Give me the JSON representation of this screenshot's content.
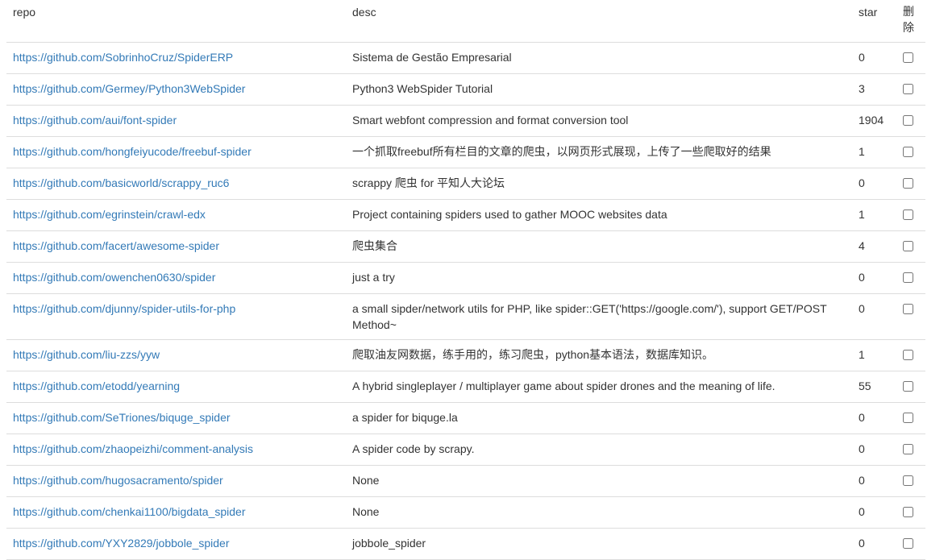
{
  "headers": {
    "repo": "repo",
    "desc": "desc",
    "star": "star",
    "delete": "删除"
  },
  "rows": [
    {
      "repo": "https://github.com/SobrinhoCruz/SpiderERP",
      "desc": "Sistema de Gestão Empresarial",
      "star": "0"
    },
    {
      "repo": "https://github.com/Germey/Python3WebSpider",
      "desc": "Python3 WebSpider Tutorial",
      "star": "3"
    },
    {
      "repo": "https://github.com/aui/font-spider",
      "desc": "Smart webfont compression and format conversion tool",
      "star": "1904"
    },
    {
      "repo": "https://github.com/hongfeiyucode/freebuf-spider",
      "desc": "一个抓取freebuf所有栏目的文章的爬虫，以网页形式展现，上传了一些爬取好的结果",
      "star": "1"
    },
    {
      "repo": "https://github.com/basicworld/scrappy_ruc6",
      "desc": "scrappy 爬虫 for 平知人大论坛",
      "star": "0"
    },
    {
      "repo": "https://github.com/egrinstein/crawl-edx",
      "desc": "Project containing spiders used to gather MOOC websites data",
      "star": "1"
    },
    {
      "repo": "https://github.com/facert/awesome-spider",
      "desc": "爬虫集合",
      "star": "4"
    },
    {
      "repo": "https://github.com/owenchen0630/spider",
      "desc": "just a try",
      "star": "0"
    },
    {
      "repo": "https://github.com/djunny/spider-utils-for-php",
      "desc": "a small sipder/network utils for PHP, like spider::GET('https://google.com/'), support GET/POST Method~",
      "star": "0"
    },
    {
      "repo": "https://github.com/liu-zzs/yyw",
      "desc": "爬取油友网数据，练手用的，练习爬虫，python基本语法，数据库知识。",
      "star": "1"
    },
    {
      "repo": "https://github.com/etodd/yearning",
      "desc": "A hybrid singleplayer / multiplayer game about spider drones and the meaning of life.",
      "star": "55"
    },
    {
      "repo": "https://github.com/SeTriones/biquge_spider",
      "desc": "a spider for biquge.la",
      "star": "0"
    },
    {
      "repo": "https://github.com/zhaopeizhi/comment-analysis",
      "desc": "A spider code by scrapy.",
      "star": "0"
    },
    {
      "repo": "https://github.com/hugosacramento/spider",
      "desc": "None",
      "star": "0"
    },
    {
      "repo": "https://github.com/chenkai1100/bigdata_spider",
      "desc": "None",
      "star": "0"
    },
    {
      "repo": "https://github.com/YXY2829/jobbole_spider",
      "desc": "jobbole_spider",
      "star": "0"
    }
  ]
}
